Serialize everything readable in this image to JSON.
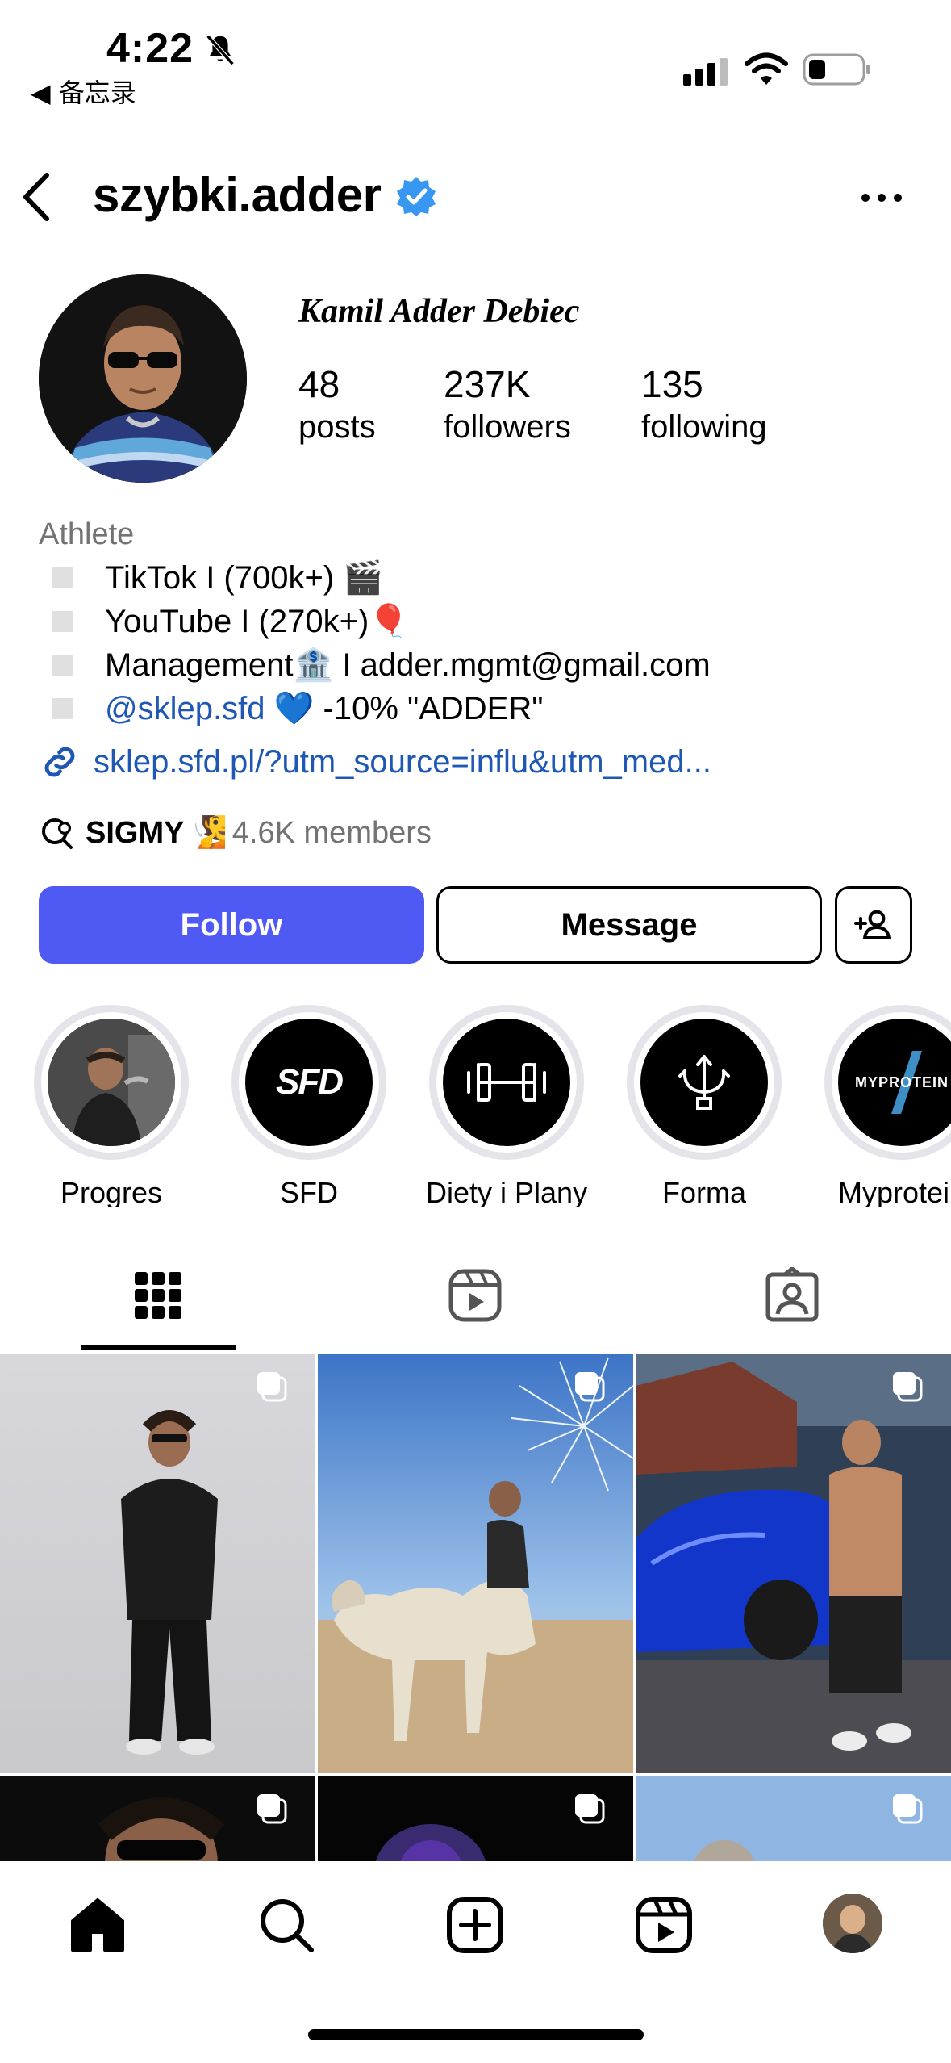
{
  "status_bar": {
    "time": "4:22",
    "back_app": "◀ 备忘录"
  },
  "header": {
    "username": "szybki.adder"
  },
  "profile": {
    "display_name": "Kamil Adder Debiec",
    "stats": {
      "posts_value": "48",
      "posts_label": "posts",
      "followers_value": "237K",
      "followers_label": "followers",
      "following_value": "135",
      "following_label": "following"
    },
    "category": "Athlete",
    "bio_lines": [
      "TikTok I (700k+) 🎬",
      "YouTube I (270k+)🎈",
      "Management🏦 I adder.mgmt@gmail.com"
    ],
    "bio_mention": "@sklep.sfd",
    "bio_mention_rest": " 💙 -10% \"ADDER\"",
    "link": "sklep.sfd.pl/?utm_source=influ&utm_med...",
    "channel_name": "SIGMY",
    "channel_emoji": "🧏",
    "channel_members": "4.6K members"
  },
  "buttons": {
    "follow": "Follow",
    "message": "Message"
  },
  "highlights": [
    {
      "label": "Progres"
    },
    {
      "label": "SFD",
      "logo": "SFD"
    },
    {
      "label": "Diety i Plany"
    },
    {
      "label": "Forma"
    },
    {
      "label": "Myprotein",
      "logo": "MYPROTEIN"
    }
  ],
  "colors": {
    "follow_blue": "#4e5af3",
    "link_blue": "#1f57b4",
    "verified_blue": "#3897f0",
    "muted_gray": "#737373"
  }
}
